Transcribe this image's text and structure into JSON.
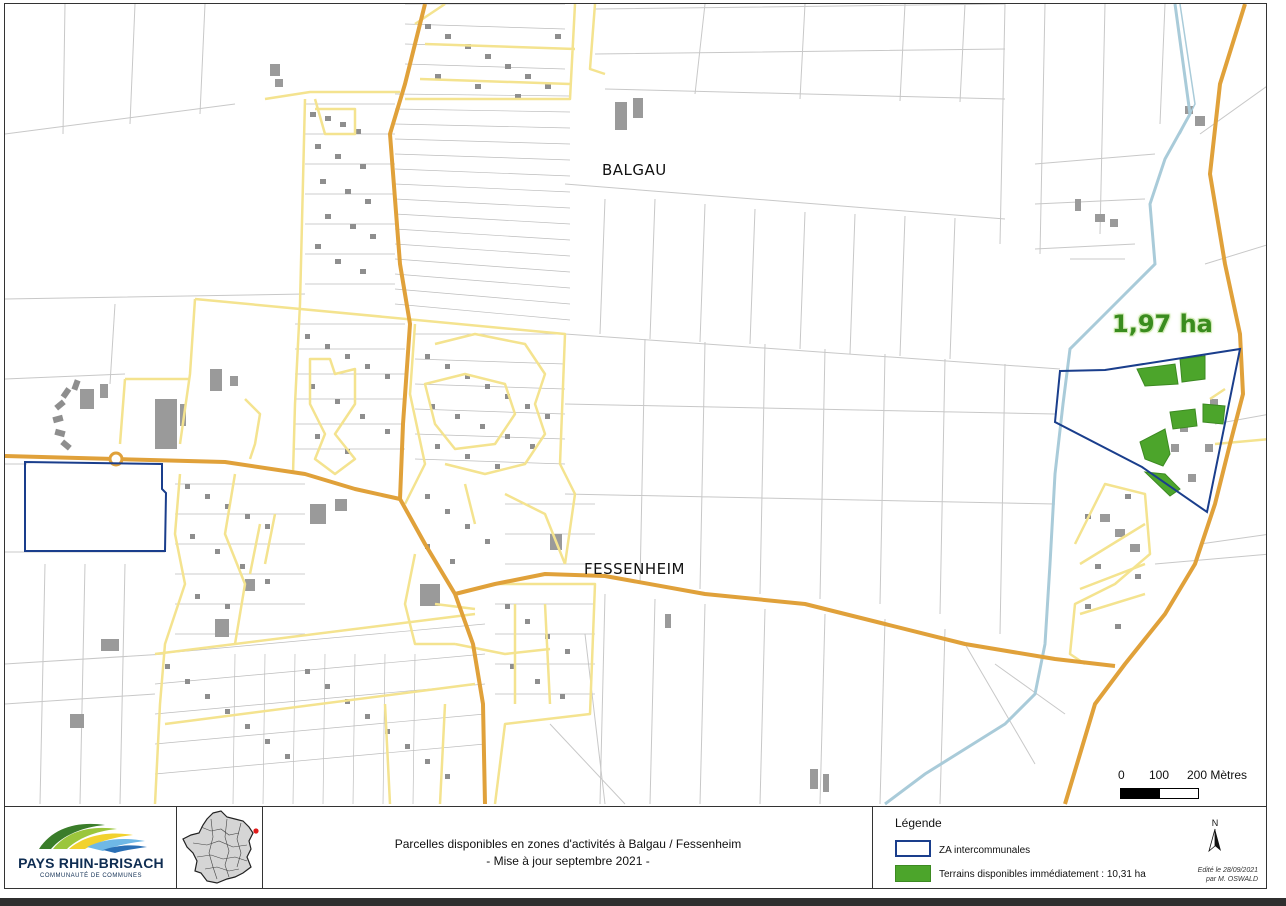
{
  "map": {
    "place_labels": {
      "balgau": "BALGAU",
      "fessenheim": "FESSENHEIM"
    },
    "area_label": "1,97 ha",
    "scale": {
      "zero": "0",
      "hundred": "100",
      "two_hundred": "200 Mètres"
    },
    "colors": {
      "main_road": "#e0a13a",
      "local_road": "#f4e38f",
      "za_boundary": "#1a3e8c",
      "available_land": "#4ca52b",
      "canal": "#a9cbd9",
      "buildings": "#9a9a9a",
      "parcels": "#c8c8c8"
    }
  },
  "footer": {
    "logo": {
      "name": "PAYS RHIN-BRISACH",
      "subtitle": "COMMUNAUTÉ DE COMMUNES"
    },
    "title": {
      "line1": "Parcelles disponibles en zones d'activités à Balgau / Fessenheim",
      "line2": "- Mise à jour septembre 2021 -"
    },
    "legend": {
      "title": "Légende",
      "items": [
        {
          "label": "ZA intercommunales",
          "color": "#1a3e8c"
        },
        {
          "label": "Terrains disponibles immédiatement : 10,31 ha",
          "color": "#4ca52b"
        }
      ]
    },
    "north_label": "N",
    "credit": {
      "line1": "Edité le 28/09/2021",
      "line2": "par M. OSWALD"
    }
  }
}
